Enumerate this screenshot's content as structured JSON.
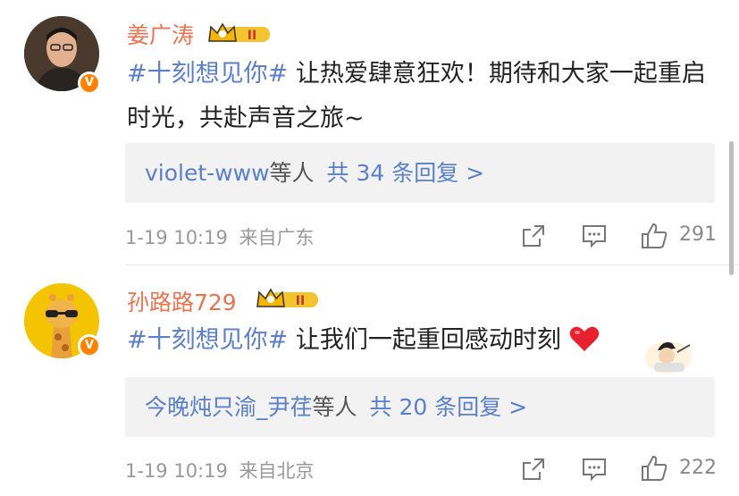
{
  "comments": [
    {
      "username": "姜广涛",
      "topic": "#十刻想见你#",
      "text_after_topic": " 让热爱肆意狂欢！期待和大家一起重启时光，共赴声音之旅~",
      "reply_users": "violet-www",
      "reply_etc": "等人",
      "reply_count": "共 34 条回复 >",
      "datetime": "1-19 10:19",
      "location": "来自广东",
      "likes": "291",
      "level_badge": "II"
    },
    {
      "username": "孙路路729",
      "topic": "#十刻想见你#",
      "text_after_topic": " 让我们一起重回感动时刻",
      "reply_users": "今晚炖只渝_尹荏",
      "reply_etc": "等人",
      "reply_count": "共 20 条回复 >",
      "datetime": "1-19 10:19",
      "location": "来自北京",
      "likes": "222",
      "level_badge": "II"
    }
  ],
  "verified_badge": "V",
  "icons": [
    "share-icon",
    "comment-icon",
    "like-icon",
    "heart-emoji-icon",
    "sticker-emoji-icon",
    "crown-level-icon"
  ],
  "colors": {
    "username": "#eb7350",
    "topic": "#5b7fc8",
    "verified": "#ff8200",
    "heart": "#e8212e"
  }
}
